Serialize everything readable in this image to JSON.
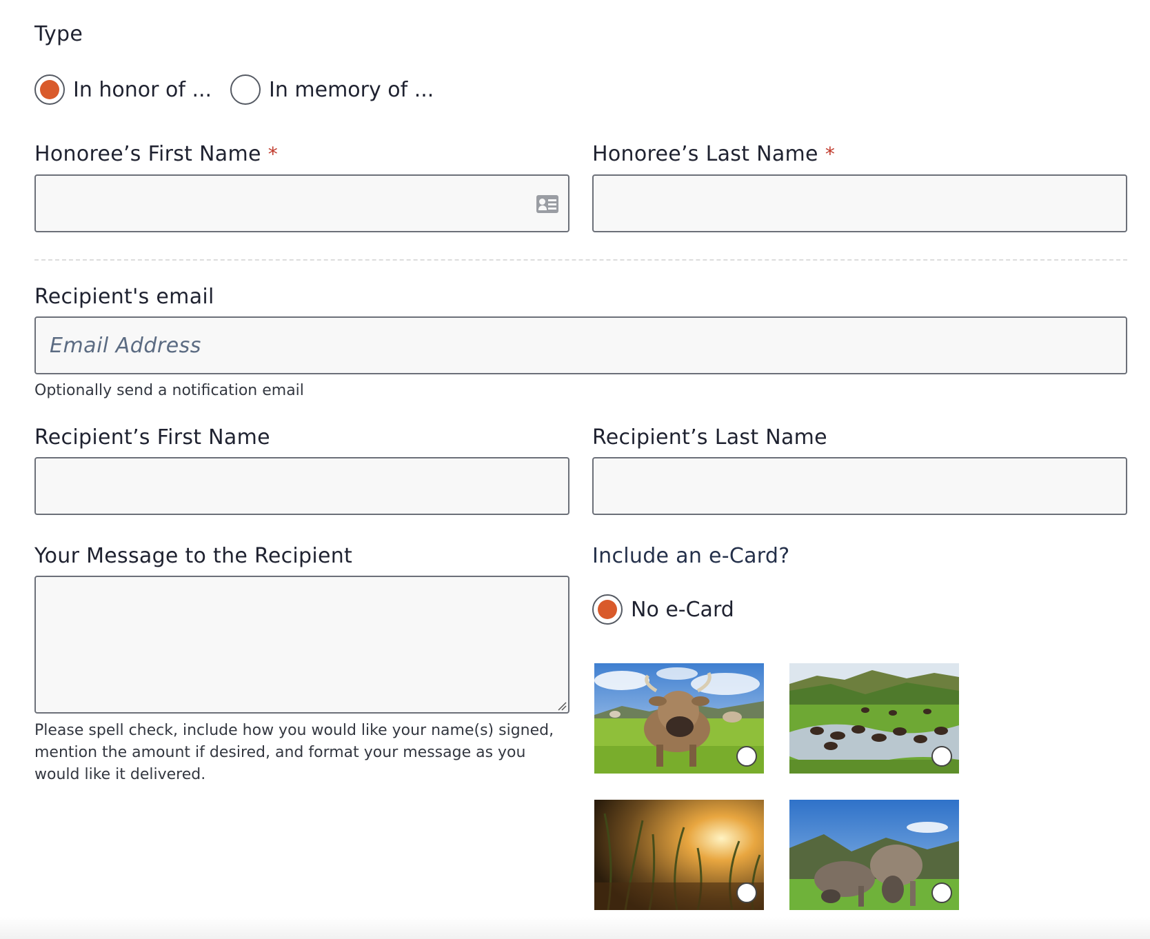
{
  "type_section": {
    "label": "Type",
    "options": [
      {
        "label": "In honor of ...",
        "selected": true
      },
      {
        "label": "In memory of ...",
        "selected": false
      }
    ]
  },
  "honoree": {
    "first_name_label": "Honoree’s First Name",
    "last_name_label": "Honoree’s Last Name",
    "required_mark": "*"
  },
  "recipient": {
    "email_label": "Recipient's email",
    "email_placeholder": "Email Address",
    "email_help": "Optionally send a notification email",
    "first_name_label": "Recipient’s First Name",
    "last_name_label": "Recipient’s Last Name"
  },
  "message": {
    "label": "Your Message to the Recipient",
    "help_lines": [
      "Please spell check, include how you would like your name(s) signed,",
      "mention the amount if desired, and format your message as you",
      "would like it delivered."
    ]
  },
  "ecard": {
    "label": "Include an e-Card?",
    "no_card_label": "No e-Card",
    "no_card_selected": true,
    "cards": [
      {
        "icon": "cow-meadow-image"
      },
      {
        "icon": "bison-river-image"
      },
      {
        "icon": "grass-sunset-image"
      },
      {
        "icon": "cows-grazing-image"
      }
    ]
  },
  "colors": {
    "accent": "#d95a2b",
    "required": "#c0392b",
    "border": "#6b6f78",
    "field_bg": "#f8f8f8"
  }
}
